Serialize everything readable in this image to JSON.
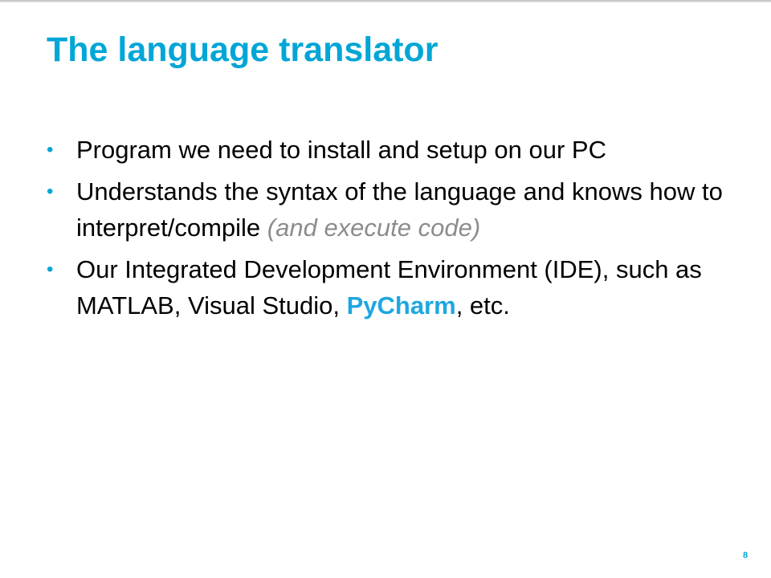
{
  "slide": {
    "title": "The language translator",
    "bullets": [
      {
        "text": "Program we need to install and setup on our PC"
      },
      {
        "text": "Understands the syntax of the language and knows how to interpret/compile ",
        "muted": "(and execute code)"
      },
      {
        "text": "Our Integrated Development Environment (IDE), such as MATLAB, Visual Studio, ",
        "highlight": "PyCharm",
        "tail": ", etc."
      }
    ],
    "bullet_symbol": "•",
    "page_number": "8"
  },
  "colors": {
    "accent": "#00A6D6",
    "muted": "#8c8c8c"
  }
}
